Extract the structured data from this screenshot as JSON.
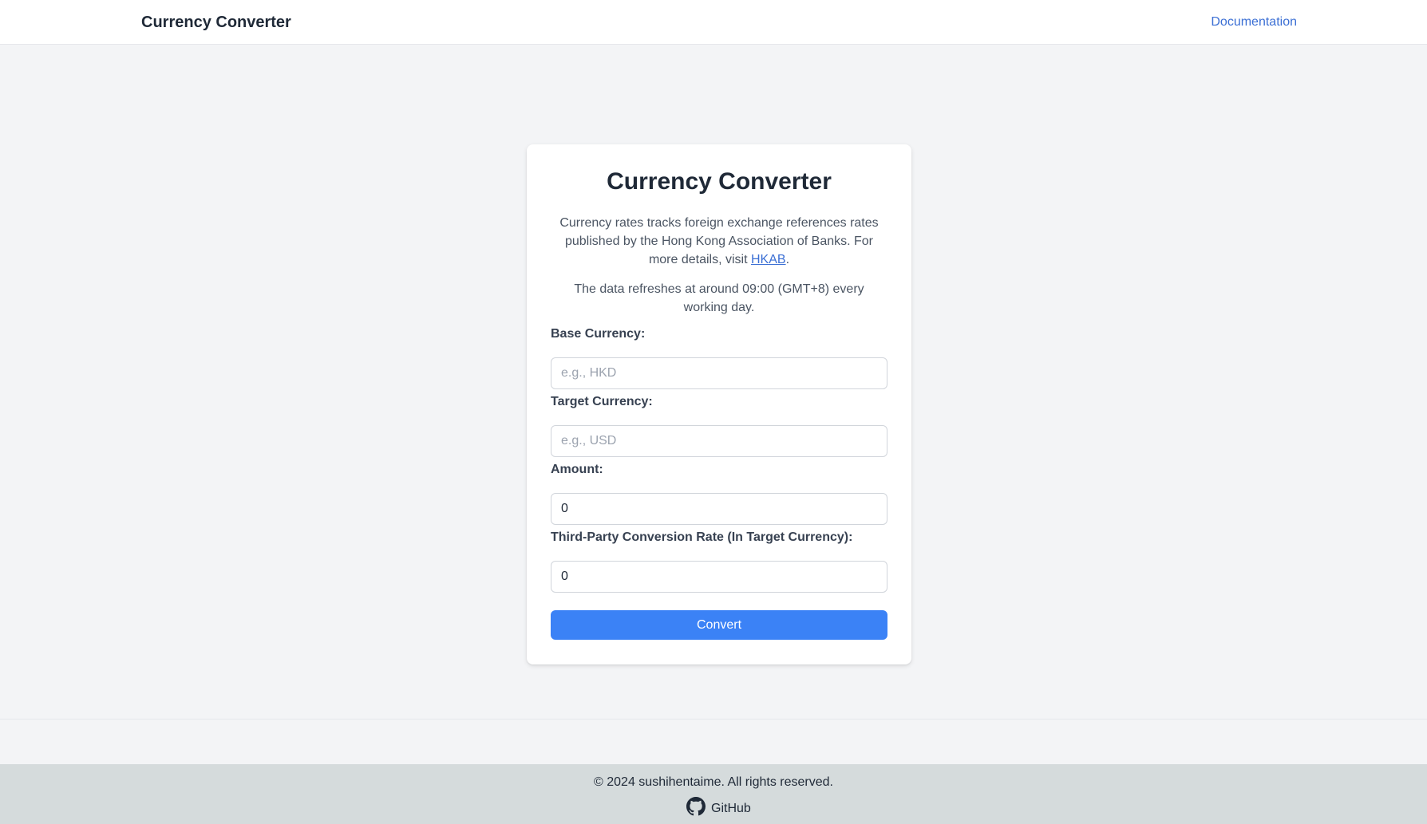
{
  "header": {
    "brand": "Currency Converter",
    "documentation_link": "Documentation"
  },
  "card": {
    "title": "Currency Converter",
    "description_before_link": "Currency rates tracks foreign exchange references rates published by the Hong Kong Association of Banks. For more details, visit ",
    "description_link": "HKAB",
    "description_after_link": ".",
    "refresh_note": "The data refreshes at around 09:00 (GMT+8) every working day."
  },
  "form": {
    "base_currency": {
      "label": "Base Currency:",
      "placeholder": "e.g., HKD",
      "value": ""
    },
    "target_currency": {
      "label": "Target Currency:",
      "placeholder": "e.g., USD",
      "value": ""
    },
    "amount": {
      "label": "Amount:",
      "value": "0"
    },
    "third_party_rate": {
      "label": "Third-Party Conversion Rate (In Target Currency):",
      "value": "0"
    },
    "convert_button": "Convert"
  },
  "footer": {
    "copyright": "© 2024 sushihentaime. All rights reserved.",
    "github_label": "GitHub",
    "github_icon": "github-icon"
  },
  "colors": {
    "accent": "#3b82f6",
    "link": "#3b6fd4",
    "background": "#f3f4f6",
    "footer_background": "#d5dbdc"
  }
}
